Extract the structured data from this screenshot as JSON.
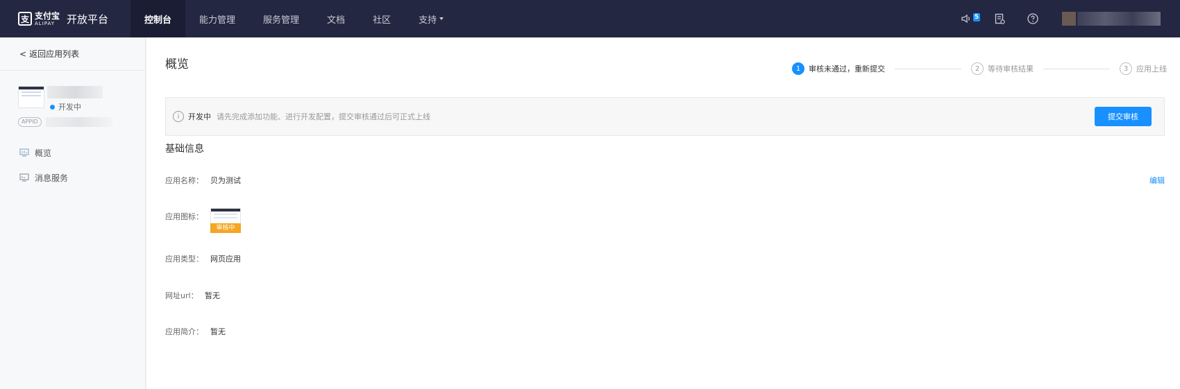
{
  "header": {
    "brand_cn": "支付宝",
    "brand_en": "ALIPAY",
    "platform": "开放平台",
    "nav": [
      {
        "label": "控制台",
        "active": true
      },
      {
        "label": "能力管理",
        "active": false
      },
      {
        "label": "服务管理",
        "active": false
      },
      {
        "label": "文档",
        "active": false
      },
      {
        "label": "社区",
        "active": false
      },
      {
        "label": "支持",
        "active": false,
        "dropdown": true
      }
    ],
    "notification_count": "5",
    "icons": [
      "speaker-icon",
      "document-icon",
      "help-icon"
    ]
  },
  "sidebar": {
    "back_label": "返回应用列表",
    "app": {
      "status": "开发中",
      "appid_tag": "APPID"
    },
    "menu": [
      {
        "label": "概览",
        "icon": "overview-icon"
      },
      {
        "label": "消息服务",
        "icon": "message-icon"
      }
    ]
  },
  "main": {
    "title": "概览",
    "steps": [
      {
        "num": "1",
        "label": "审核未通过，重新提交",
        "active": true
      },
      {
        "num": "2",
        "label": "等待审核结果",
        "active": false
      },
      {
        "num": "3",
        "label": "应用上线",
        "active": false
      }
    ],
    "notice": {
      "status": "开发中",
      "text": "请先完成添加功能、进行开发配置，提交审核通过后可正式上线",
      "button": "提交审核"
    },
    "section_title": "基础信息",
    "edit_label": "编辑",
    "fields": {
      "name_label": "应用名称：",
      "name_value": "贝为测试",
      "icon_label": "应用图标：",
      "icon_tag": "审核中",
      "type_label": "应用类型：",
      "type_value": "网页应用",
      "url_label": "网址url：",
      "url_value": "暂无",
      "intro_label": "应用简介：",
      "intro_value": "暂无"
    }
  },
  "colors": {
    "topbar": "#232741",
    "accent": "#1890ff",
    "review_tag": "#f5a623"
  }
}
